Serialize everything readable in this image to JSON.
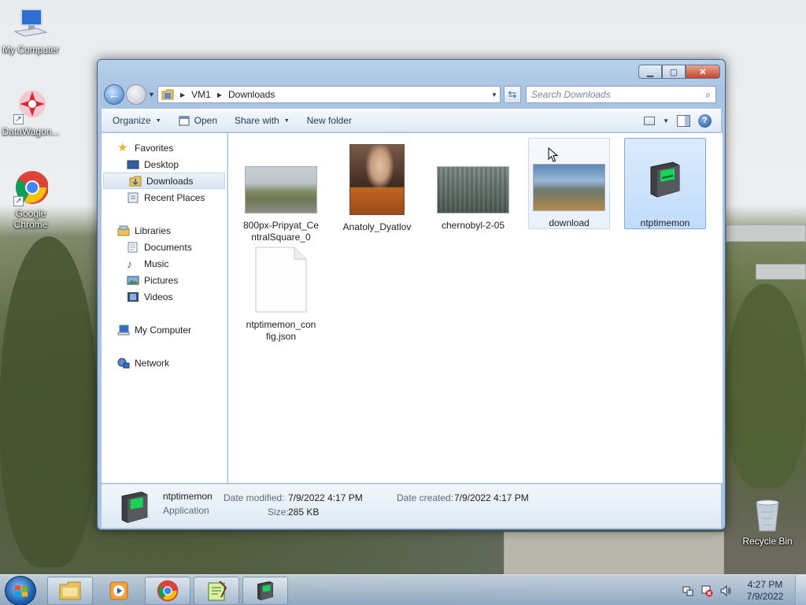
{
  "desktop": {
    "icons": [
      {
        "label": "My Computer"
      },
      {
        "label": "DataWagon..."
      },
      {
        "label": "Google Chrome"
      },
      {
        "label": "Recycle Bin"
      }
    ]
  },
  "window": {
    "address": {
      "segments": [
        "VM1",
        "Downloads"
      ]
    },
    "search": {
      "placeholder": "Search Downloads"
    },
    "toolbar": {
      "organize": "Organize",
      "open": "Open",
      "share_with": "Share with",
      "new_folder": "New folder"
    },
    "nav": {
      "favorites": "Favorites",
      "desktop": "Desktop",
      "downloads": "Downloads",
      "recent_places": "Recent Places",
      "libraries": "Libraries",
      "documents": "Documents",
      "music": "Music",
      "pictures": "Pictures",
      "videos": "Videos",
      "my_computer": "My Computer",
      "network": "Network"
    },
    "files": [
      {
        "name_line1": "800px-Pripyat_Ce",
        "name_line2": "ntralSquare_0"
      },
      {
        "name_line1": "Anatoly_Dyatlov"
      },
      {
        "name_line1": "chernobyl-2-05"
      },
      {
        "name_line1": "download"
      },
      {
        "name_line1": "ntptimemon"
      },
      {
        "name_line1": "ntptimemon_con",
        "name_line2": "fig.json"
      }
    ],
    "details": {
      "name": "ntptimemon",
      "type": "Application",
      "date_modified_label": "Date modified:",
      "date_modified": "7/9/2022 4:17 PM",
      "date_created_label": "Date created:",
      "date_created": "7/9/2022 4:17 PM",
      "size_label": "Size:",
      "size": "285 KB"
    }
  },
  "taskbar": {
    "time": "4:27 PM",
    "date": "7/9/2022"
  }
}
